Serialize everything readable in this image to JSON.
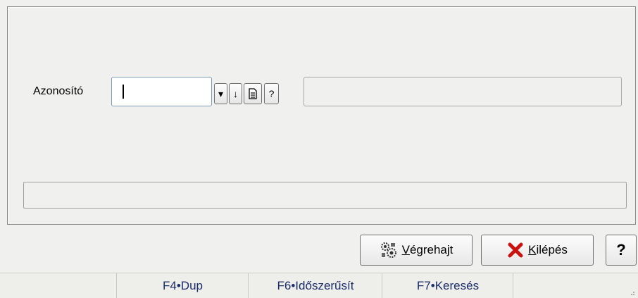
{
  "form": {
    "id_label": "Azonosító",
    "id_value": "",
    "lookup_buttons": [
      "▾",
      "↓",
      "🗎",
      "?"
    ]
  },
  "buttons": {
    "execute_first": "V",
    "execute_rest": "égrehajt",
    "exit_first": "K",
    "exit_rest": "ilépés",
    "help": "?"
  },
  "statusbar": {
    "items": [
      "F4•Dup",
      "F6•Időszerűsít",
      "F7•Keresés"
    ]
  },
  "colors": {
    "statusbar_text": "#1a2d6b",
    "exit_icon": "#cc1111"
  }
}
